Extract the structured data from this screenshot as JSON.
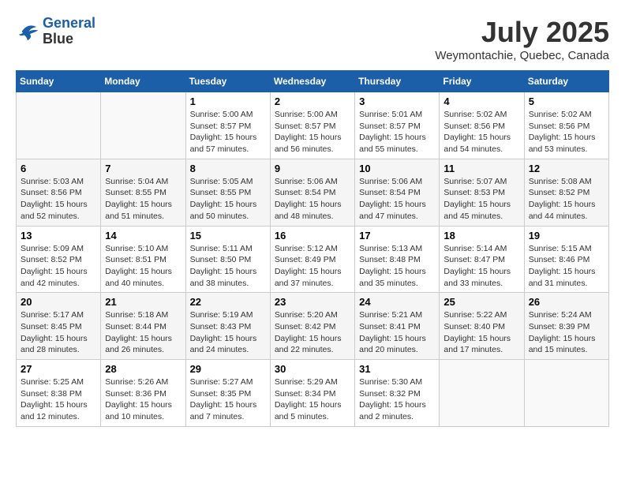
{
  "logo": {
    "line1": "General",
    "line2": "Blue"
  },
  "title": "July 2025",
  "location": "Weymontachie, Quebec, Canada",
  "weekdays": [
    "Sunday",
    "Monday",
    "Tuesday",
    "Wednesday",
    "Thursday",
    "Friday",
    "Saturday"
  ],
  "weeks": [
    [
      {
        "day": "",
        "info": ""
      },
      {
        "day": "",
        "info": ""
      },
      {
        "day": "1",
        "info": "Sunrise: 5:00 AM\nSunset: 8:57 PM\nDaylight: 15 hours\nand 57 minutes."
      },
      {
        "day": "2",
        "info": "Sunrise: 5:00 AM\nSunset: 8:57 PM\nDaylight: 15 hours\nand 56 minutes."
      },
      {
        "day": "3",
        "info": "Sunrise: 5:01 AM\nSunset: 8:57 PM\nDaylight: 15 hours\nand 55 minutes."
      },
      {
        "day": "4",
        "info": "Sunrise: 5:02 AM\nSunset: 8:56 PM\nDaylight: 15 hours\nand 54 minutes."
      },
      {
        "day": "5",
        "info": "Sunrise: 5:02 AM\nSunset: 8:56 PM\nDaylight: 15 hours\nand 53 minutes."
      }
    ],
    [
      {
        "day": "6",
        "info": "Sunrise: 5:03 AM\nSunset: 8:56 PM\nDaylight: 15 hours\nand 52 minutes."
      },
      {
        "day": "7",
        "info": "Sunrise: 5:04 AM\nSunset: 8:55 PM\nDaylight: 15 hours\nand 51 minutes."
      },
      {
        "day": "8",
        "info": "Sunrise: 5:05 AM\nSunset: 8:55 PM\nDaylight: 15 hours\nand 50 minutes."
      },
      {
        "day": "9",
        "info": "Sunrise: 5:06 AM\nSunset: 8:54 PM\nDaylight: 15 hours\nand 48 minutes."
      },
      {
        "day": "10",
        "info": "Sunrise: 5:06 AM\nSunset: 8:54 PM\nDaylight: 15 hours\nand 47 minutes."
      },
      {
        "day": "11",
        "info": "Sunrise: 5:07 AM\nSunset: 8:53 PM\nDaylight: 15 hours\nand 45 minutes."
      },
      {
        "day": "12",
        "info": "Sunrise: 5:08 AM\nSunset: 8:52 PM\nDaylight: 15 hours\nand 44 minutes."
      }
    ],
    [
      {
        "day": "13",
        "info": "Sunrise: 5:09 AM\nSunset: 8:52 PM\nDaylight: 15 hours\nand 42 minutes."
      },
      {
        "day": "14",
        "info": "Sunrise: 5:10 AM\nSunset: 8:51 PM\nDaylight: 15 hours\nand 40 minutes."
      },
      {
        "day": "15",
        "info": "Sunrise: 5:11 AM\nSunset: 8:50 PM\nDaylight: 15 hours\nand 38 minutes."
      },
      {
        "day": "16",
        "info": "Sunrise: 5:12 AM\nSunset: 8:49 PM\nDaylight: 15 hours\nand 37 minutes."
      },
      {
        "day": "17",
        "info": "Sunrise: 5:13 AM\nSunset: 8:48 PM\nDaylight: 15 hours\nand 35 minutes."
      },
      {
        "day": "18",
        "info": "Sunrise: 5:14 AM\nSunset: 8:47 PM\nDaylight: 15 hours\nand 33 minutes."
      },
      {
        "day": "19",
        "info": "Sunrise: 5:15 AM\nSunset: 8:46 PM\nDaylight: 15 hours\nand 31 minutes."
      }
    ],
    [
      {
        "day": "20",
        "info": "Sunrise: 5:17 AM\nSunset: 8:45 PM\nDaylight: 15 hours\nand 28 minutes."
      },
      {
        "day": "21",
        "info": "Sunrise: 5:18 AM\nSunset: 8:44 PM\nDaylight: 15 hours\nand 26 minutes."
      },
      {
        "day": "22",
        "info": "Sunrise: 5:19 AM\nSunset: 8:43 PM\nDaylight: 15 hours\nand 24 minutes."
      },
      {
        "day": "23",
        "info": "Sunrise: 5:20 AM\nSunset: 8:42 PM\nDaylight: 15 hours\nand 22 minutes."
      },
      {
        "day": "24",
        "info": "Sunrise: 5:21 AM\nSunset: 8:41 PM\nDaylight: 15 hours\nand 20 minutes."
      },
      {
        "day": "25",
        "info": "Sunrise: 5:22 AM\nSunset: 8:40 PM\nDaylight: 15 hours\nand 17 minutes."
      },
      {
        "day": "26",
        "info": "Sunrise: 5:24 AM\nSunset: 8:39 PM\nDaylight: 15 hours\nand 15 minutes."
      }
    ],
    [
      {
        "day": "27",
        "info": "Sunrise: 5:25 AM\nSunset: 8:38 PM\nDaylight: 15 hours\nand 12 minutes."
      },
      {
        "day": "28",
        "info": "Sunrise: 5:26 AM\nSunset: 8:36 PM\nDaylight: 15 hours\nand 10 minutes."
      },
      {
        "day": "29",
        "info": "Sunrise: 5:27 AM\nSunset: 8:35 PM\nDaylight: 15 hours\nand 7 minutes."
      },
      {
        "day": "30",
        "info": "Sunrise: 5:29 AM\nSunset: 8:34 PM\nDaylight: 15 hours\nand 5 minutes."
      },
      {
        "day": "31",
        "info": "Sunrise: 5:30 AM\nSunset: 8:32 PM\nDaylight: 15 hours\nand 2 minutes."
      },
      {
        "day": "",
        "info": ""
      },
      {
        "day": "",
        "info": ""
      }
    ]
  ]
}
